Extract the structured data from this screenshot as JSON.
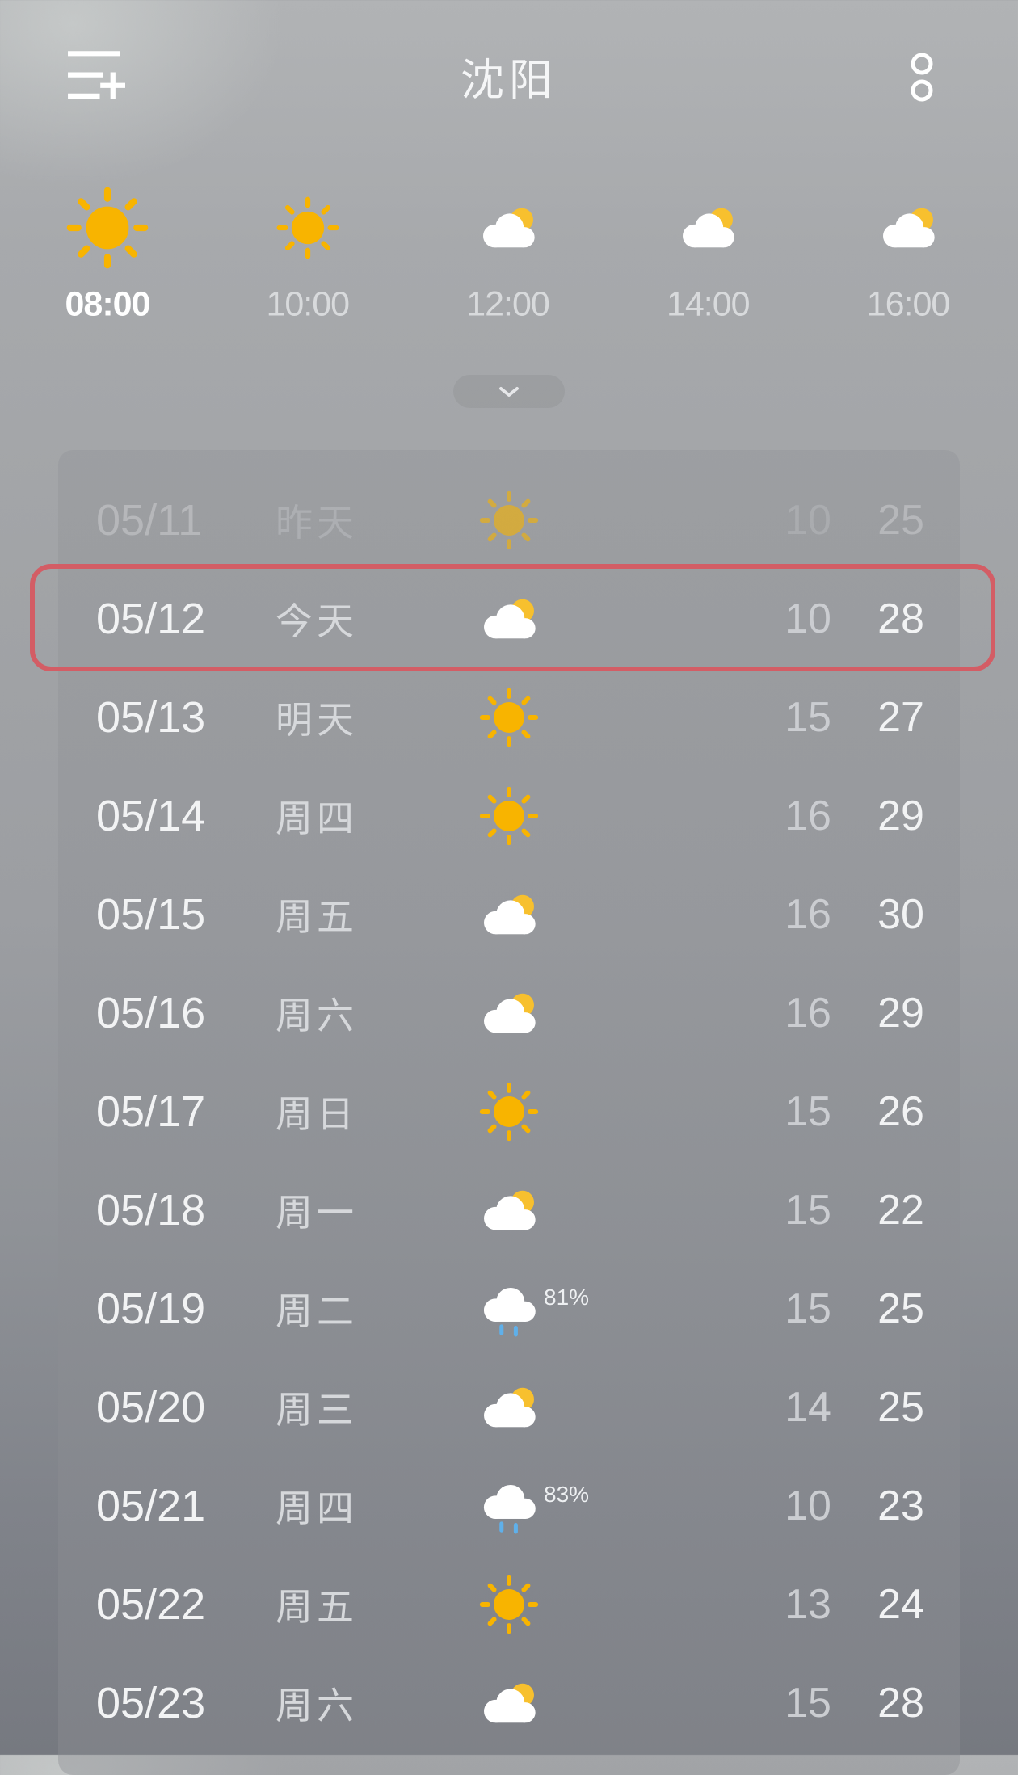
{
  "header": {
    "title": "沈阳",
    "menu_icon": "menu-add-icon",
    "more_icon": "more-dots-icon"
  },
  "colors": {
    "sun": "#f8b400",
    "sun_small": "#f7c02e",
    "cloud": "#ffffff",
    "rain_drop": "#5fb0ea",
    "highlight_border": "#d35d65",
    "icon_stroke": "#ffffff"
  },
  "hourly": [
    {
      "time": "08:00",
      "icon": "sun",
      "selected": true
    },
    {
      "time": "10:00",
      "icon": "sun",
      "selected": false
    },
    {
      "time": "12:00",
      "icon": "cloud-sun",
      "selected": false
    },
    {
      "time": "14:00",
      "icon": "cloud-sun",
      "selected": false
    },
    {
      "time": "16:00",
      "icon": "cloud-sun",
      "selected": false
    }
  ],
  "expand_icon": "chevron-down-icon",
  "daily": [
    {
      "date": "05/11",
      "day": "昨天",
      "icon": "sun",
      "low": "10",
      "high": "25",
      "past": true
    },
    {
      "date": "05/12",
      "day": "今天",
      "icon": "cloud-sun",
      "low": "10",
      "high": "28",
      "highlighted": true
    },
    {
      "date": "05/13",
      "day": "明天",
      "icon": "sun",
      "low": "15",
      "high": "27"
    },
    {
      "date": "05/14",
      "day": "周四",
      "icon": "sun",
      "low": "16",
      "high": "29"
    },
    {
      "date": "05/15",
      "day": "周五",
      "icon": "cloud-sun",
      "low": "16",
      "high": "30"
    },
    {
      "date": "05/16",
      "day": "周六",
      "icon": "cloud-sun",
      "low": "16",
      "high": "29"
    },
    {
      "date": "05/17",
      "day": "周日",
      "icon": "sun",
      "low": "15",
      "high": "26"
    },
    {
      "date": "05/18",
      "day": "周一",
      "icon": "cloud-sun",
      "low": "15",
      "high": "22"
    },
    {
      "date": "05/19",
      "day": "周二",
      "icon": "rain-cloud",
      "precip": "81%",
      "low": "15",
      "high": "25"
    },
    {
      "date": "05/20",
      "day": "周三",
      "icon": "cloud-sun",
      "low": "14",
      "high": "25"
    },
    {
      "date": "05/21",
      "day": "周四",
      "icon": "rain-cloud",
      "precip": "83%",
      "low": "10",
      "high": "23"
    },
    {
      "date": "05/22",
      "day": "周五",
      "icon": "sun",
      "low": "13",
      "high": "24"
    },
    {
      "date": "05/23",
      "day": "周六",
      "icon": "cloud-sun",
      "low": "15",
      "high": "28"
    }
  ]
}
